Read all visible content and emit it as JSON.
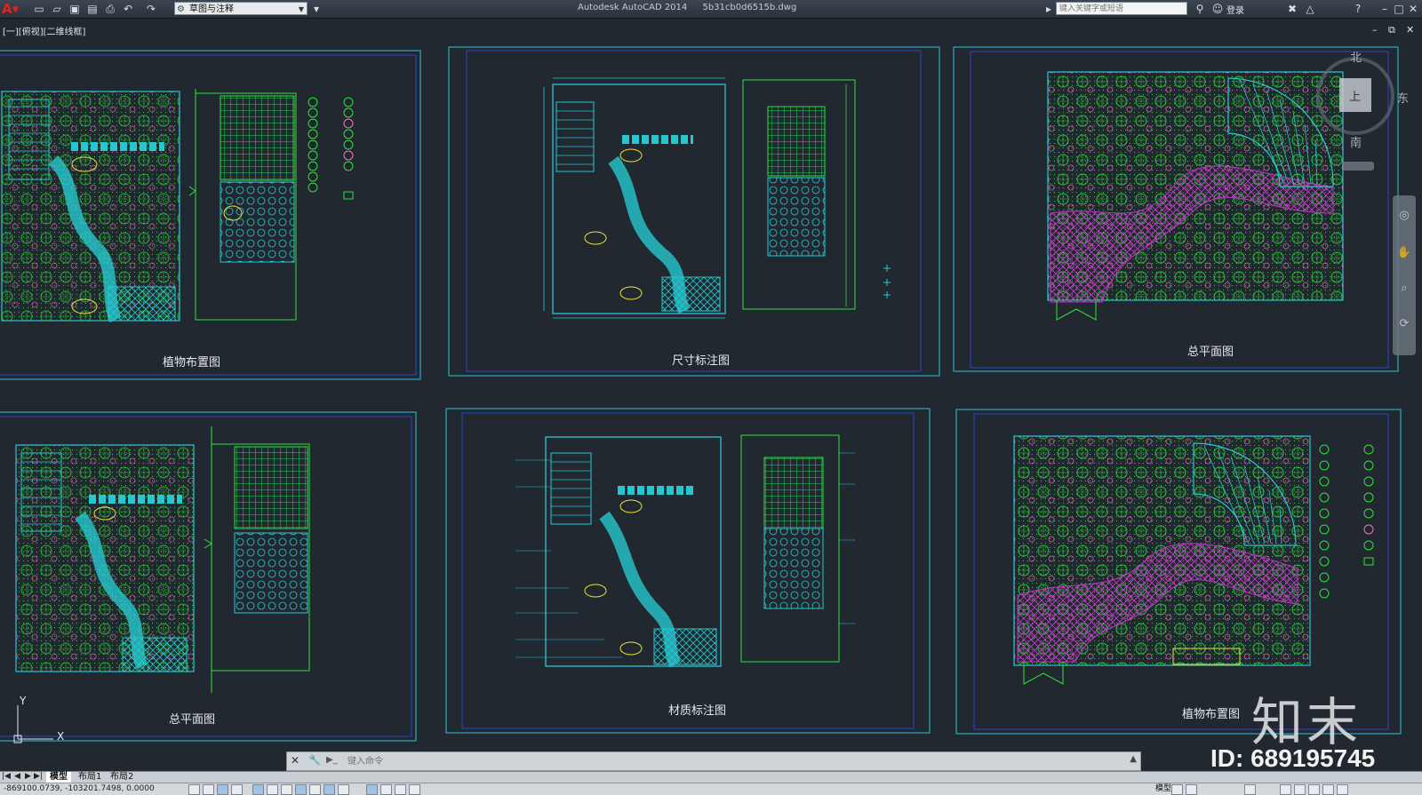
{
  "app": {
    "title": "Autodesk AutoCAD 2014",
    "filename": "5b31cb0d6515b.dwg"
  },
  "toolbar": {
    "workspace": "草图与注释",
    "search_placeholder": "键入关键字或短语",
    "login_label": "登录"
  },
  "viewport": {
    "label": "[一][俯视][二维线框]"
  },
  "viewcube": {
    "north": "北",
    "east": "东",
    "south": "南",
    "top": "上"
  },
  "sheets": [
    {
      "title": "植物布置图"
    },
    {
      "title": "尺寸标注图"
    },
    {
      "title": "总平面图"
    },
    {
      "title": "总平面图"
    },
    {
      "title": "材质标注图"
    },
    {
      "title": "植物布置图"
    }
  ],
  "command": {
    "placeholder": "键入命令",
    "prompt": "▶_"
  },
  "tabs": {
    "model": "模型",
    "layout1": "布局1",
    "layout2": "布局2"
  },
  "status": {
    "coords": "-869100.0739, -103201.7498, 0.0000",
    "model_label": "模型"
  },
  "ucs": {
    "x": "X",
    "y": "Y"
  },
  "watermark": {
    "logo": "知末",
    "id": "ID: 689195745"
  },
  "colors": {
    "background": "#212830",
    "frame": "#2ec3d6",
    "inner_frame": "#2a46c9",
    "plants": "#31e23a",
    "paving": "#27c7cf",
    "highlight": "#e8e83a",
    "accent": "#c535c9",
    "flower": "#f07ab8"
  }
}
